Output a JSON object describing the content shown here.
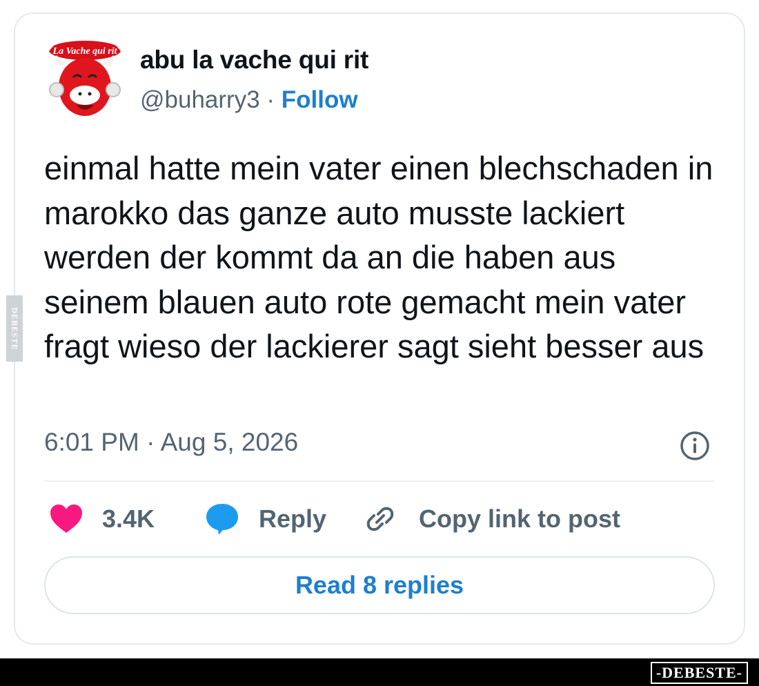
{
  "author": {
    "display_name": "abu la vache qui rit",
    "handle": "@buharry3",
    "separator": "·",
    "follow_label": "Follow",
    "avatar_logo_text": "La Vache qui rit"
  },
  "tweet": {
    "text": "einmal hatte mein vater einen blechschaden in marokko das ganze auto musste lackiert werden der kommt da an die haben aus seinem blauen auto rote gemacht mein vater fragt wieso der lackierer sagt sieht besser aus",
    "timestamp": "6:01 PM · Aug 5, 2026"
  },
  "actions": {
    "likes_count": "3.4K",
    "reply_label": "Reply",
    "copy_link_label": "Copy link to post",
    "read_replies_label": "Read 8 replies"
  },
  "watermarks": {
    "side": "DEBESTE",
    "footer": "-DEBESTE-"
  },
  "colors": {
    "like": "#f91880",
    "reply": "#1d9bf0",
    "link": "#1d7fd0",
    "secondary_text": "#536471"
  }
}
